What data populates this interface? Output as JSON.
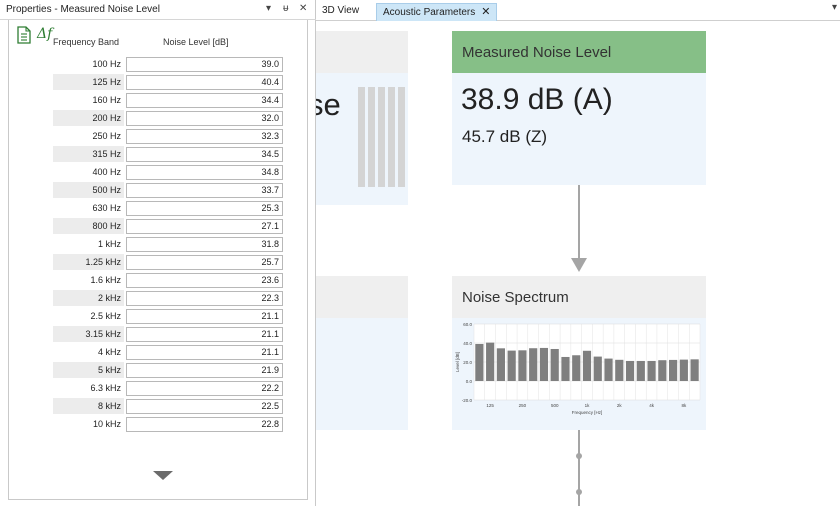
{
  "panel": {
    "title": "Properties - Measured Noise Level",
    "dropdown_glyph": "▾",
    "pin_glyph": "ᵾ",
    "close_glyph": "✕",
    "delta_f_label": "Δf",
    "headers": {
      "band": "Frequency Band",
      "level": "Noise Level [dB]"
    },
    "rows": [
      {
        "band": "100 Hz",
        "value": "39.0"
      },
      {
        "band": "125 Hz",
        "value": "40.4"
      },
      {
        "band": "160 Hz",
        "value": "34.4"
      },
      {
        "band": "200 Hz",
        "value": "32.0"
      },
      {
        "band": "250 Hz",
        "value": "32.3"
      },
      {
        "band": "315 Hz",
        "value": "34.5"
      },
      {
        "band": "400 Hz",
        "value": "34.8"
      },
      {
        "band": "500 Hz",
        "value": "33.7"
      },
      {
        "band": "630 Hz",
        "value": "25.3"
      },
      {
        "band": "800 Hz",
        "value": "27.1"
      },
      {
        "band": "1 kHz",
        "value": "31.8"
      },
      {
        "band": "1.25 kHz",
        "value": "25.7"
      },
      {
        "band": "1.6 kHz",
        "value": "23.6"
      },
      {
        "band": "2 kHz",
        "value": "22.3"
      },
      {
        "band": "2.5 kHz",
        "value": "21.1"
      },
      {
        "band": "3.15 kHz",
        "value": "21.1"
      },
      {
        "band": "4 kHz",
        "value": "21.1"
      },
      {
        "band": "5 kHz",
        "value": "21.9"
      },
      {
        "band": "6.3 kHz",
        "value": "22.2"
      },
      {
        "band": "8 kHz",
        "value": "22.5"
      },
      {
        "band": "10 kHz",
        "value": "22.8"
      }
    ]
  },
  "tabs": [
    {
      "label": "3D View",
      "active": false
    },
    {
      "label": "Acoustic Parameters",
      "active": true,
      "close_glyph": "✕"
    }
  ],
  "tab_menu_glyph": "▾",
  "canvas": {
    "left_partial_text": "se",
    "measured_card": {
      "title": "Measured Noise Level",
      "head_color": "#86bf87",
      "value_a": "38.9  dB (A)",
      "value_z": "45.7  dB (Z)"
    },
    "spectrum_card": {
      "title": "Noise Spectrum",
      "head_color": "#efefef"
    }
  },
  "chart_data": {
    "type": "bar",
    "xlabel": "Frequency [Hz]",
    "ylabel": "Level [dB]",
    "ylim": [
      -20,
      60
    ],
    "yticks": [
      "60.0",
      "40.0",
      "20.0",
      "0.0",
      "-20.0"
    ],
    "xtick_labels": [
      "125",
      "250",
      "500",
      "1k",
      "2k",
      "4k",
      "8k"
    ],
    "categories": [
      "100",
      "125",
      "160",
      "200",
      "250",
      "315",
      "400",
      "500",
      "630",
      "800",
      "1k",
      "1.25k",
      "1.6k",
      "2k",
      "2.5k",
      "3.15k",
      "4k",
      "5k",
      "6.3k",
      "8k",
      "10k"
    ],
    "values": [
      39.0,
      40.4,
      34.4,
      32.0,
      32.3,
      34.5,
      34.8,
      33.7,
      25.3,
      27.1,
      31.8,
      25.7,
      23.6,
      22.3,
      21.1,
      21.1,
      21.1,
      21.9,
      22.2,
      22.5,
      22.8
    ],
    "bar_color": "#7f7f7f",
    "grid": true
  }
}
